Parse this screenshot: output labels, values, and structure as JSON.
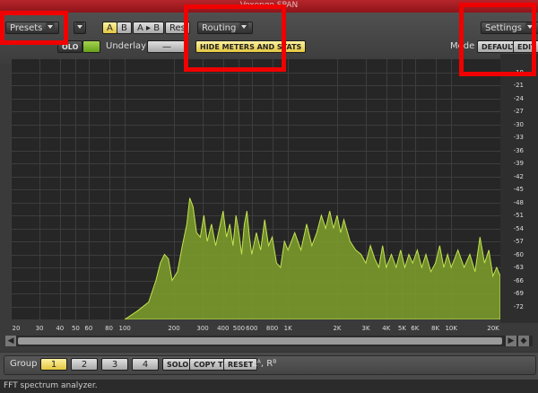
{
  "window": {
    "title": "Voxengo SPAN"
  },
  "toolbar": {
    "presets": "Presets",
    "ab_a": "A",
    "ab_b": "B",
    "ab_copy": "A ▸ B",
    "reset": "Res",
    "routing": "Routing",
    "hide_meters": "HIDE METERS AND STATS",
    "settings": "Settings",
    "solo_label": "OLO",
    "underlay_label": "Underlay",
    "underlay_value": "—",
    "mode_label": "Mode",
    "mode_default": "DEFAULT",
    "edit": "EDIT"
  },
  "y_axis_labels": [
    "-18",
    "-21",
    "-24",
    "-27",
    "-30",
    "-33",
    "-36",
    "-39",
    "-42",
    "-45",
    "-48",
    "-51",
    "-54",
    "-57",
    "-60",
    "-63",
    "-66",
    "-69",
    "-72"
  ],
  "x_axis_labels": [
    {
      "t": "20",
      "f": 20
    },
    {
      "t": "30",
      "f": 30
    },
    {
      "t": "40",
      "f": 40
    },
    {
      "t": "50",
      "f": 50
    },
    {
      "t": "60",
      "f": 60
    },
    {
      "t": "80",
      "f": 80
    },
    {
      "t": "100",
      "f": 100
    },
    {
      "t": "200",
      "f": 200
    },
    {
      "t": "300",
      "f": 300
    },
    {
      "t": "400",
      "f": 400
    },
    {
      "t": "500",
      "f": 500
    },
    {
      "t": "600",
      "f": 600
    },
    {
      "t": "800",
      "f": 800
    },
    {
      "t": "1K",
      "f": 1000
    },
    {
      "t": "2K",
      "f": 2000
    },
    {
      "t": "3K",
      "f": 3000
    },
    {
      "t": "4K",
      "f": 4000
    },
    {
      "t": "5K",
      "f": 5000
    },
    {
      "t": "6K",
      "f": 6000
    },
    {
      "t": "8K",
      "f": 8000
    },
    {
      "t": "10K",
      "f": 10000
    },
    {
      "t": "20K",
      "f": 20000
    }
  ],
  "spectrum": [
    [
      100,
      -75
    ],
    [
      120,
      -73
    ],
    [
      140,
      -71
    ],
    [
      155,
      -66
    ],
    [
      165,
      -62
    ],
    [
      175,
      -60
    ],
    [
      185,
      -61
    ],
    [
      195,
      -66
    ],
    [
      210,
      -64
    ],
    [
      225,
      -58
    ],
    [
      240,
      -53
    ],
    [
      250,
      -47
    ],
    [
      262,
      -49
    ],
    [
      275,
      -55
    ],
    [
      290,
      -56
    ],
    [
      305,
      -51
    ],
    [
      320,
      -57
    ],
    [
      340,
      -53
    ],
    [
      360,
      -58
    ],
    [
      380,
      -54
    ],
    [
      400,
      -50
    ],
    [
      420,
      -56
    ],
    [
      440,
      -53
    ],
    [
      460,
      -58
    ],
    [
      480,
      -51
    ],
    [
      500,
      -55
    ],
    [
      520,
      -60
    ],
    [
      540,
      -53
    ],
    [
      560,
      -50
    ],
    [
      580,
      -56
    ],
    [
      600,
      -60
    ],
    [
      640,
      -55
    ],
    [
      680,
      -59
    ],
    [
      720,
      -52
    ],
    [
      760,
      -58
    ],
    [
      800,
      -56
    ],
    [
      850,
      -62
    ],
    [
      900,
      -63
    ],
    [
      950,
      -57
    ],
    [
      1000,
      -59
    ],
    [
      1100,
      -55
    ],
    [
      1200,
      -59
    ],
    [
      1300,
      -53
    ],
    [
      1400,
      -58
    ],
    [
      1500,
      -55
    ],
    [
      1600,
      -51
    ],
    [
      1700,
      -54
    ],
    [
      1800,
      -50
    ],
    [
      1900,
      -54
    ],
    [
      2000,
      -51
    ],
    [
      2100,
      -55
    ],
    [
      2200,
      -52
    ],
    [
      2400,
      -57
    ],
    [
      2600,
      -59
    ],
    [
      2800,
      -60
    ],
    [
      3000,
      -62
    ],
    [
      3200,
      -58
    ],
    [
      3400,
      -61
    ],
    [
      3600,
      -63
    ],
    [
      3800,
      -58
    ],
    [
      4000,
      -63
    ],
    [
      4300,
      -60
    ],
    [
      4600,
      -63
    ],
    [
      4900,
      -59
    ],
    [
      5200,
      -63
    ],
    [
      5500,
      -60
    ],
    [
      5800,
      -62
    ],
    [
      6200,
      -59
    ],
    [
      6600,
      -63
    ],
    [
      7000,
      -60
    ],
    [
      7500,
      -64
    ],
    [
      8000,
      -62
    ],
    [
      8500,
      -58
    ],
    [
      9000,
      -63
    ],
    [
      9500,
      -60
    ],
    [
      10000,
      -63
    ],
    [
      11000,
      -59
    ],
    [
      12000,
      -63
    ],
    [
      13000,
      -60
    ],
    [
      14000,
      -64
    ],
    [
      15000,
      -56
    ],
    [
      16000,
      -62
    ],
    [
      17000,
      -59
    ],
    [
      18000,
      -65
    ],
    [
      19000,
      -63
    ],
    [
      20000,
      -65
    ]
  ],
  "bottom": {
    "group_label": "Group",
    "g1": "1",
    "g2": "2",
    "g3": "3",
    "g4": "4",
    "solo": "SOLO",
    "copy_to": "COPY TO",
    "reset": "RESET",
    "lr": "Lᴬ, Rᴮ"
  },
  "status": "FFT spectrum analyzer."
}
